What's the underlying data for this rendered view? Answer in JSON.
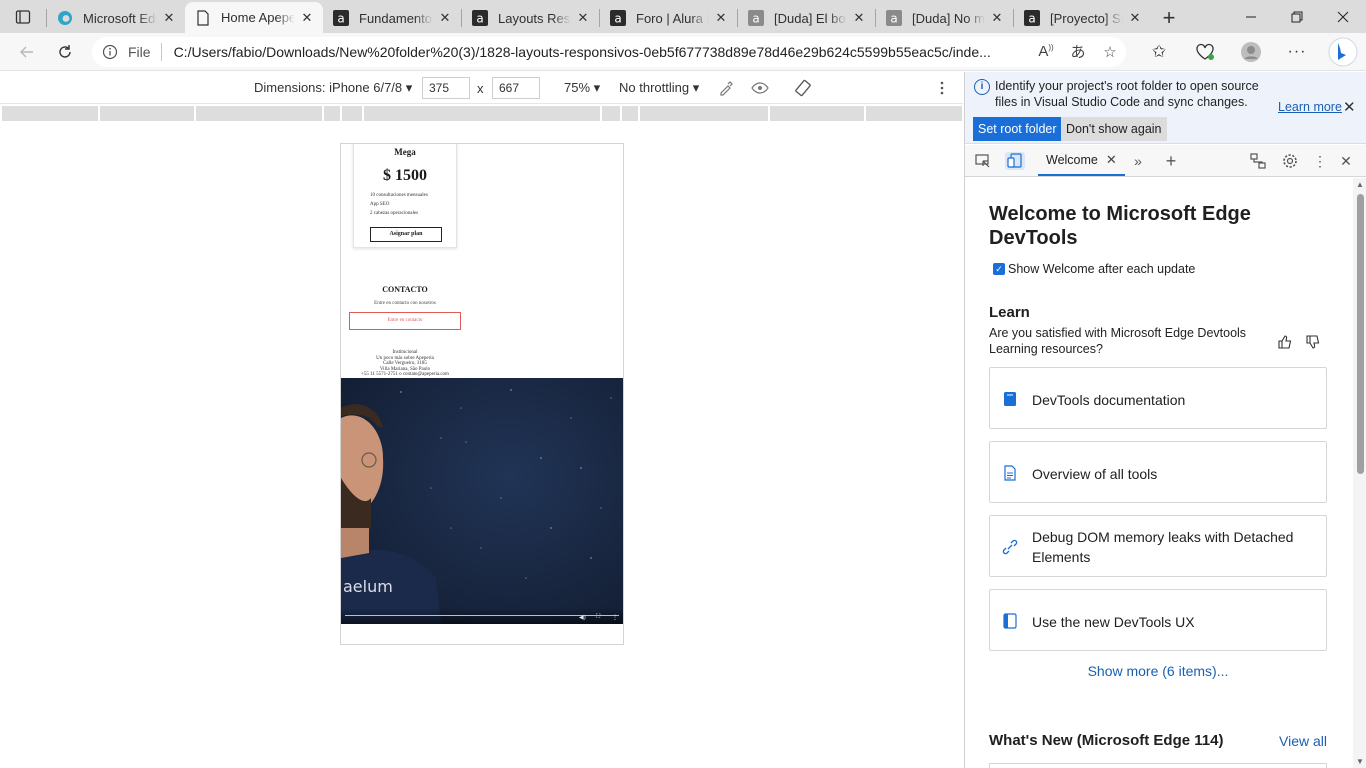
{
  "browser": {
    "tabs": [
      {
        "title": "Microsoft Edg",
        "icon": "edge-icon",
        "active": false
      },
      {
        "title": "Home Apeper",
        "icon": "page-icon",
        "active": true
      },
      {
        "title": "Fundamentos",
        "icon": "alura-icon",
        "active": false
      },
      {
        "title": "Layouts Resp",
        "icon": "alura-icon",
        "active": false
      },
      {
        "title": "Foro | Alura La",
        "icon": "alura-icon",
        "active": false
      },
      {
        "title": "[Duda] El botó",
        "icon": "alura-icon",
        "active": false
      },
      {
        "title": "[Duda] No me",
        "icon": "alura-icon",
        "active": false
      },
      {
        "title": "[Proyecto] SE(",
        "icon": "alura-icon",
        "active": false
      }
    ],
    "address": {
      "scheme_label": "File",
      "url": "C:/Users/fabio/Downloads/New%20folder%20(3)/1828-layouts-responsivos-0eb5f677738d89e78d46e29b624c5599b55eac5c/inde..."
    }
  },
  "device_toolbar": {
    "dimensions_label": "Dimensions: iPhone 6/7/8",
    "width": "375",
    "height": "667",
    "times": "x",
    "zoom": "75%",
    "throttling": "No throttling"
  },
  "page": {
    "plan": {
      "name": "Mega",
      "price": "$ 1500",
      "features": [
        "10 consultaciones mensuales",
        "App SEO",
        "2 cabezas operacionales"
      ],
      "button": "Asignar plan"
    },
    "contact": {
      "title": "CONTACTO",
      "subtitle": "Entre en contacto con nosotros",
      "button": "Entre en contacto"
    },
    "footer": [
      "Institucional",
      "Un poco más sobre Apeperia",
      "Calle Vergueiro, 3185",
      "Villa Mariana, São Paulo",
      "+55 11 5571-2751 o contato@apeperia.com"
    ],
    "video": {
      "shirt_text": "aelum"
    }
  },
  "devtools": {
    "infobar": {
      "text": "Identify your project's root folder to open source files in Visual Studio Code and sync changes.",
      "learn_more": "Learn more",
      "set_root": "Set root folder",
      "dont_show": "Don't show again"
    },
    "tab_label": "Welcome",
    "welcome": {
      "title": "Welcome to Microsoft Edge DevTools",
      "show_welcome": "Show Welcome after each update",
      "learn_heading": "Learn",
      "question": "Are you satisfied with Microsoft Edge Devtools Learning resources?",
      "cards": [
        {
          "label": "DevTools documentation",
          "icon": "book-icon"
        },
        {
          "label": "Overview of all tools",
          "icon": "document-icon"
        },
        {
          "label": "Debug DOM memory leaks with Detached Elements",
          "icon": "link-icon"
        },
        {
          "label": "Use the new DevTools UX",
          "icon": "panel-icon"
        }
      ],
      "show_more": "Show more (6 items)...",
      "whats_new": "What's New (Microsoft Edge 114)",
      "view_all": "View all"
    },
    "colors": {
      "accent": "#1a6ed8",
      "link": "#1a5fb4"
    }
  }
}
